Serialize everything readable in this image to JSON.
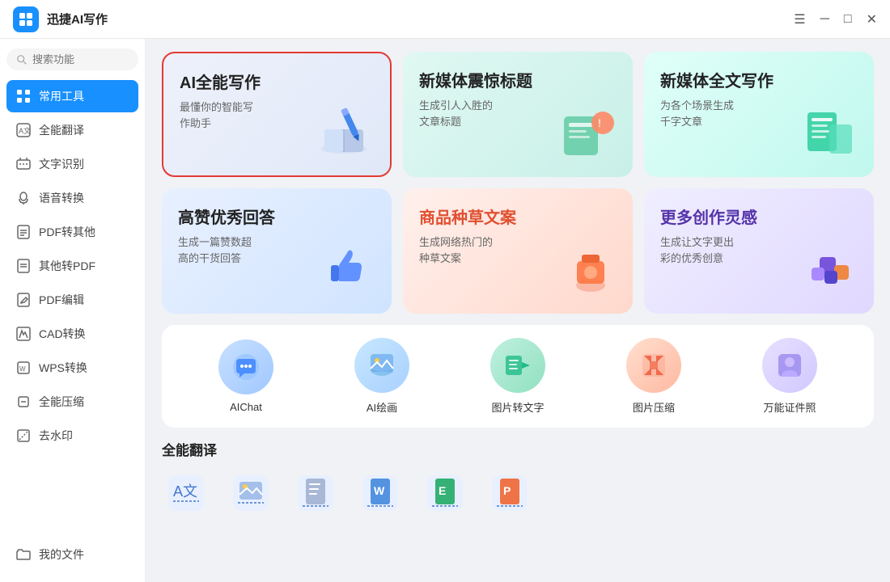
{
  "titleBar": {
    "appName": "迅捷AI写作",
    "controls": [
      "menu",
      "minimize",
      "maximize",
      "close"
    ]
  },
  "sidebar": {
    "searchPlaceholder": "搜索功能",
    "activeItem": "常用工具",
    "items": [
      {
        "id": "common-tools",
        "label": "常用工具",
        "icon": "grid"
      },
      {
        "id": "translate",
        "label": "全能翻译",
        "icon": "translate"
      },
      {
        "id": "ocr",
        "label": "文字识别",
        "icon": "ocr"
      },
      {
        "id": "speech",
        "label": "语音转换",
        "icon": "speech"
      },
      {
        "id": "pdf-other",
        "label": "PDF转其他",
        "icon": "pdf"
      },
      {
        "id": "other-pdf",
        "label": "其他转PDF",
        "icon": "pdf2"
      },
      {
        "id": "pdf-edit",
        "label": "PDF编辑",
        "icon": "edit"
      },
      {
        "id": "cad",
        "label": "CAD转换",
        "icon": "cad"
      },
      {
        "id": "wps",
        "label": "WPS转换",
        "icon": "wps"
      },
      {
        "id": "compress",
        "label": "全能压缩",
        "icon": "compress"
      },
      {
        "id": "watermark",
        "label": "去水印",
        "icon": "watermark"
      }
    ],
    "bottomItems": [
      {
        "id": "my-files",
        "label": "我的文件",
        "icon": "folder"
      }
    ]
  },
  "topCards": [
    {
      "id": "ai-writing",
      "title": "AI全能写作",
      "desc": "最懂你的智能写\n作助手",
      "bg": "card-blue",
      "selected": true
    },
    {
      "id": "newmedia-title",
      "title": "新媒体震惊标题",
      "desc": "生成引人入胜的\n文章标题",
      "bg": "card-teal",
      "selected": false
    },
    {
      "id": "newmedia-full",
      "title": "新媒体全文写作",
      "desc": "为各个场景生成\n千字文章",
      "bg": "card-teal",
      "selected": false
    }
  ],
  "midCards": [
    {
      "id": "praise-answer",
      "title": "高赞优秀回答",
      "desc": "生成一篇赞数超\n高的干货回答",
      "bg": "card-light-blue",
      "selected": false
    },
    {
      "id": "product-copy",
      "title": "商品种草文案",
      "desc": "生成网络热门的\n种草文案",
      "bg": "card-pink",
      "selected": false
    },
    {
      "id": "creative",
      "title": "更多创作灵感",
      "desc": "生成让文字更出\n彩的优秀创意",
      "bg": "card-lavender",
      "selected": false
    }
  ],
  "iconRow": [
    {
      "id": "aichat",
      "label": "AIChat",
      "bg": "#dbeafe",
      "emoji": "💬"
    },
    {
      "id": "ai-paint",
      "label": "AI绘画",
      "bg": "#dbeafe",
      "emoji": "🖼️"
    },
    {
      "id": "img-to-text",
      "label": "图片转文字",
      "bg": "#d1fae5",
      "emoji": "📷"
    },
    {
      "id": "img-compress",
      "label": "图片压缩",
      "bg": "#fee2e2",
      "emoji": "🗜️"
    },
    {
      "id": "id-photo",
      "label": "万能证件照",
      "bg": "#ede9fe",
      "emoji": "🪪"
    }
  ],
  "sectionTitle": "全能翻译",
  "bottomIcons": [
    {
      "id": "translate-aa",
      "label": "",
      "emoji": "🔤"
    },
    {
      "id": "translate-img",
      "label": "",
      "emoji": "🖼"
    },
    {
      "id": "translate-doc",
      "label": "",
      "emoji": "📄"
    },
    {
      "id": "translate-word",
      "label": "",
      "emoji": "📝"
    },
    {
      "id": "translate-excel",
      "label": "",
      "emoji": "📊"
    },
    {
      "id": "translate-ppt",
      "label": "",
      "emoji": "📑"
    }
  ]
}
